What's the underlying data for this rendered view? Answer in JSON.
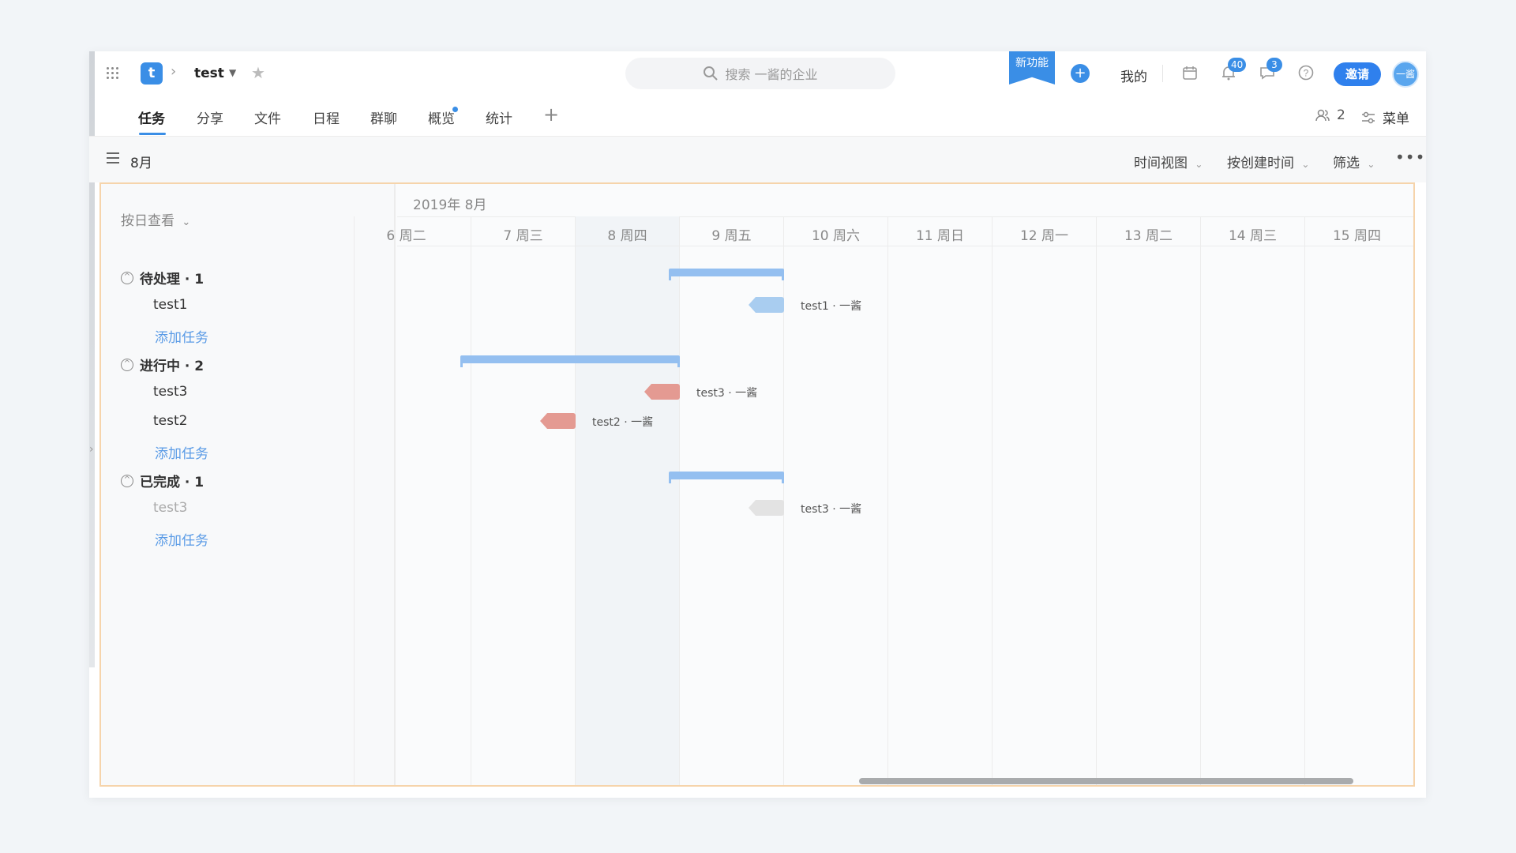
{
  "header": {
    "project_initial": "t",
    "project_name": "test",
    "search_placeholder": "搜索 一酱的企业",
    "new_feature_label": "新功能",
    "mine_label": "我的",
    "notifications_count": "40",
    "messages_count": "3",
    "invite_label": "邀请",
    "avatar_text": "一酱"
  },
  "tabs": [
    {
      "label": "任务",
      "active": true
    },
    {
      "label": "分享"
    },
    {
      "label": "文件"
    },
    {
      "label": "日程"
    },
    {
      "label": "群聊"
    },
    {
      "label": "概览",
      "has_dot": true
    },
    {
      "label": "统计"
    }
  ],
  "tab_actions": {
    "members_count": "2",
    "menu_label": "菜单"
  },
  "toolbar": {
    "month_label": "8月",
    "time_view_label": "时间视图",
    "sort_label": "按创建时间",
    "filter_label": "筛选"
  },
  "gantt": {
    "view_by_label": "按日查看",
    "month_header": "2019年 8月",
    "days": [
      "6 周二",
      "7 周三",
      "8 周四",
      "9 周五",
      "10 周六",
      "11 周日",
      "12 周一",
      "13 周二",
      "14 周三",
      "15 周四"
    ],
    "add_task_label": "添加任务",
    "groups": [
      {
        "title": "待处理 · 1",
        "tasks": [
          {
            "name": "test1",
            "bar_label": "test1 · 一酱"
          }
        ]
      },
      {
        "title": "进行中 · 2",
        "tasks": [
          {
            "name": "test3",
            "bar_label": "test3 · 一酱"
          },
          {
            "name": "test2",
            "bar_label": "test2 · 一酱"
          }
        ]
      },
      {
        "title": "已完成 · 1",
        "tasks": [
          {
            "name": "test3",
            "bar_label": "test3 · 一酱"
          }
        ]
      }
    ]
  },
  "colors": {
    "accent": "#3a8ee6",
    "pending_bar": "#a9cdf0",
    "inprogress_bar": "#e49a92",
    "done_bar": "#e3e3e3",
    "group_bar": "#94bff0",
    "highlight_border": "#f6d4ab"
  }
}
